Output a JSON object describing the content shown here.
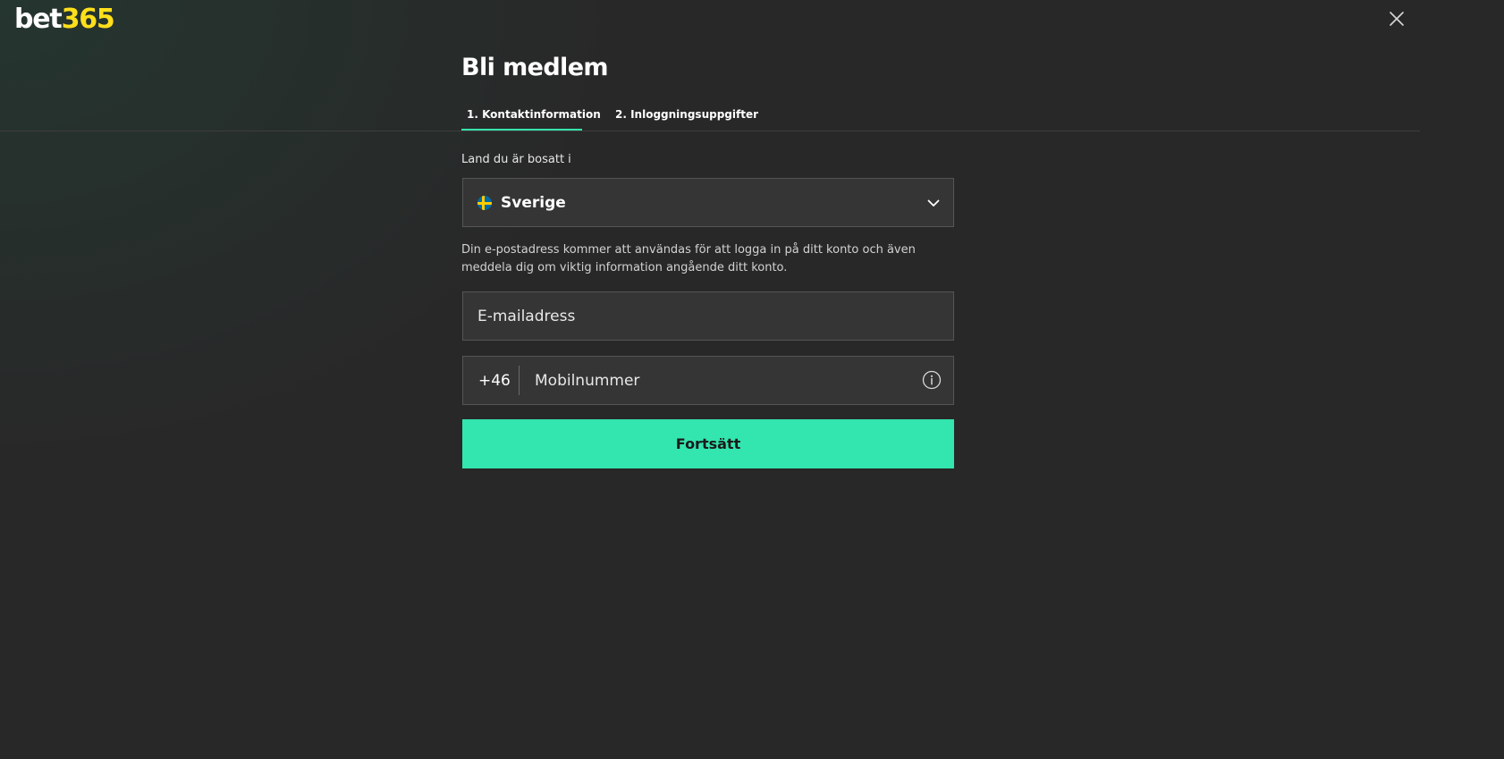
{
  "header": {
    "logo_brand": "bet",
    "logo_number": "365",
    "close_icon": "close-icon"
  },
  "form": {
    "title": "Bli medlem",
    "tabs": [
      {
        "label": "1. Kontaktinformation",
        "active": true
      },
      {
        "label": "2. Inloggningsuppgifter",
        "active": false
      }
    ],
    "country": {
      "label": "Land du är bosatt i",
      "value": "Sverige",
      "flag_icon": "sweden-flag-icon",
      "chevron_icon": "chevron-down-icon"
    },
    "email_info": "Din e-postadress kommer att användas för att logga in på ditt konto och även meddela dig om viktig information angående ditt konto.",
    "email": {
      "placeholder": "E-mailadress",
      "value": ""
    },
    "phone": {
      "prefix": "+46",
      "placeholder": "Mobilnummer",
      "value": "",
      "info_icon": "info-icon"
    },
    "submit_label": "Fortsätt"
  },
  "colors": {
    "background": "#282828",
    "field_background": "#353535",
    "field_border": "#555555",
    "accent": "#33e5ae",
    "logo_number": "#ffdf1b"
  }
}
